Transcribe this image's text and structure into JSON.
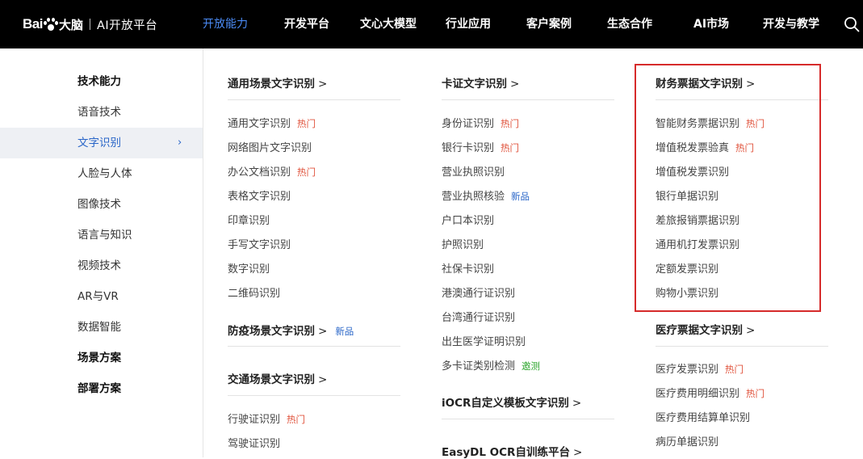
{
  "header": {
    "logo_bai": "Bai",
    "logo_du": "大脑",
    "logo_sub": "AI开放平台",
    "nav": [
      "开放能力",
      "开发平台",
      "文心大模型",
      "行业应用",
      "客户案例",
      "生态合作",
      "AI市场",
      "开发与教学"
    ],
    "active_nav": "开放能力",
    "active_color": "#4b8bf5"
  },
  "sidebar": {
    "items": [
      "技术能力",
      "语音技术",
      "文字识别",
      "人脸与人体",
      "图像技术",
      "语言与知识",
      "视频技术",
      "AR与VR",
      "数据智能",
      "场景方案",
      "部署方案"
    ],
    "selected": "文字识别",
    "chevron": "›"
  },
  "col1": {
    "s1_title": "通用场景文字识别",
    "s1_links": [
      {
        "label": "通用文字识别",
        "tag": "热门"
      },
      {
        "label": "网络图片文字识别",
        "tag": ""
      },
      {
        "label": "办公文档识别",
        "tag": "热门"
      },
      {
        "label": "表格文字识别",
        "tag": ""
      },
      {
        "label": "印章识别",
        "tag": ""
      },
      {
        "label": "手写文字识别",
        "tag": ""
      },
      {
        "label": "数字识别",
        "tag": ""
      },
      {
        "label": "二维码识别",
        "tag": ""
      }
    ],
    "s2_title": "防疫场景文字识别",
    "s2_tag": "新品",
    "s3_title": "交通场景文字识别",
    "s3_links": [
      {
        "label": "行驶证识别",
        "tag": "热门"
      },
      {
        "label": "驾驶证识别",
        "tag": ""
      }
    ]
  },
  "col2": {
    "s1_title": "卡证文字识别",
    "s1_links": [
      {
        "label": "身份证识别",
        "tag": "热门"
      },
      {
        "label": "银行卡识别",
        "tag": "热门"
      },
      {
        "label": "营业执照识别",
        "tag": ""
      },
      {
        "label": "营业执照核验",
        "tag": "新品"
      },
      {
        "label": "户口本识别",
        "tag": ""
      },
      {
        "label": "护照识别",
        "tag": ""
      },
      {
        "label": "社保卡识别",
        "tag": ""
      },
      {
        "label": "港澳通行证识别",
        "tag": ""
      },
      {
        "label": "台湾通行证识别",
        "tag": ""
      },
      {
        "label": "出生医学证明识别",
        "tag": ""
      },
      {
        "label": "多卡证类别检测",
        "tag": "邀测"
      }
    ],
    "s2_title": "iOCR自定义模板文字识别",
    "s3_title": "EasyDL OCR自训练平台"
  },
  "col3": {
    "s1_title": "财务票据文字识别",
    "s1_links": [
      {
        "label": "智能财务票据识别",
        "tag": "热门"
      },
      {
        "label": "增值税发票验真",
        "tag": "热门"
      },
      {
        "label": "增值税发票识别",
        "tag": ""
      },
      {
        "label": "银行单据识别",
        "tag": ""
      },
      {
        "label": "差旅报销票据识别",
        "tag": ""
      },
      {
        "label": "通用机打发票识别",
        "tag": ""
      },
      {
        "label": "定额发票识别",
        "tag": ""
      },
      {
        "label": "购物小票识别",
        "tag": ""
      }
    ],
    "s2_title": "医疗票据文字识别",
    "s2_links": [
      {
        "label": "医疗发票识别",
        "tag": "热门"
      },
      {
        "label": "医疗费用明细识别",
        "tag": "热门"
      },
      {
        "label": "医疗费用结算单识别",
        "tag": ""
      },
      {
        "label": "病历单据识别",
        "tag": ""
      }
    ]
  },
  "highlight_color": "#d62b2b"
}
